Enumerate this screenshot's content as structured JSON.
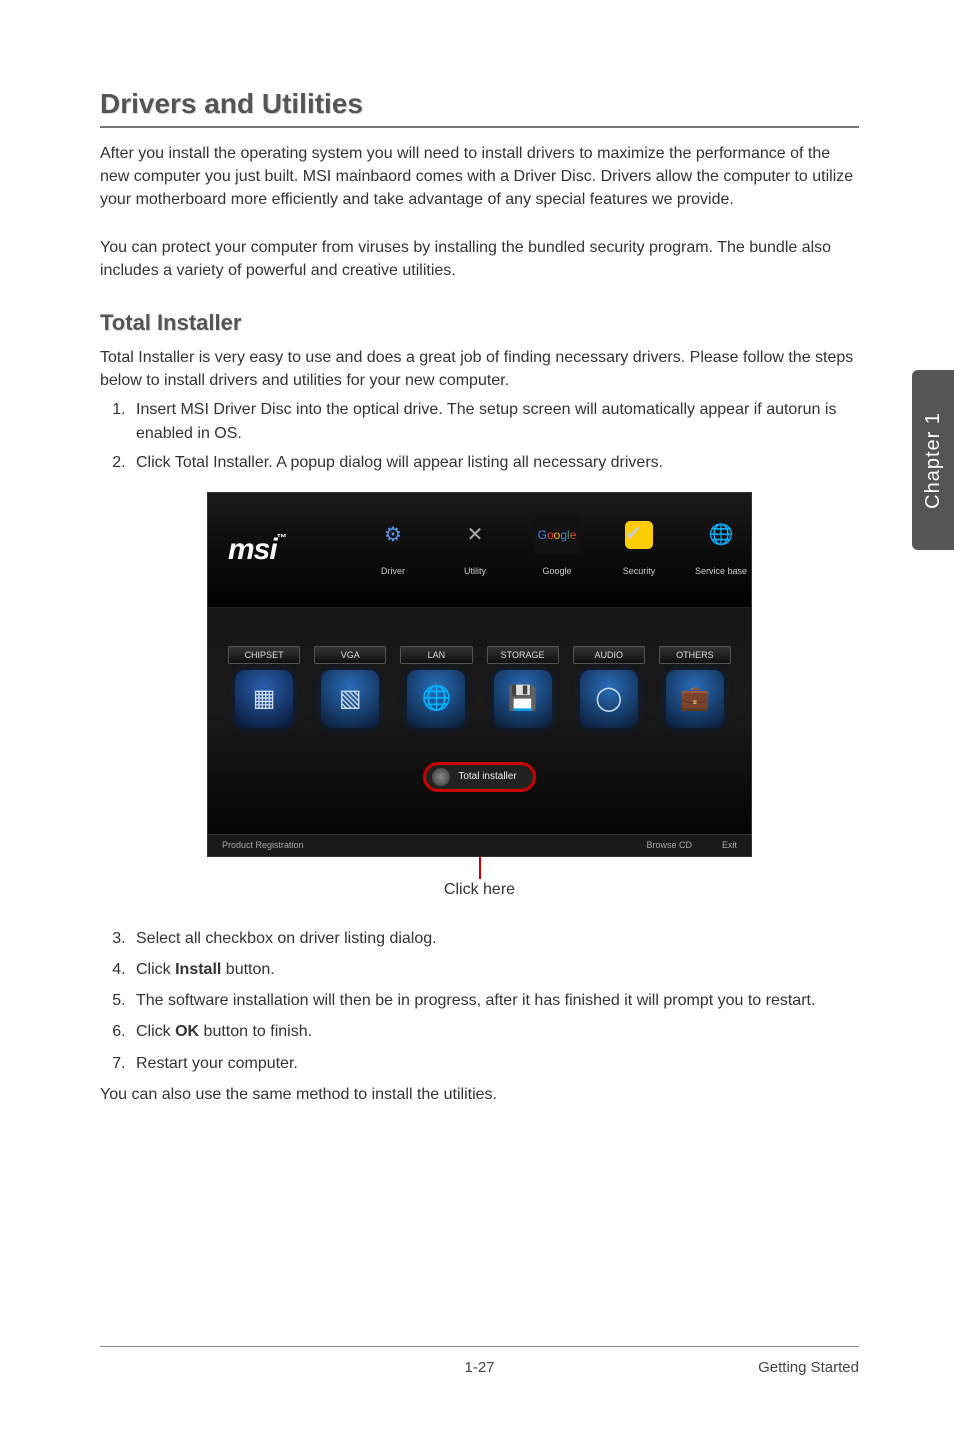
{
  "heading": "Drivers and Utilities",
  "intro1": "After you install the operating system you will need to install drivers to maximize the performance of the new computer you just built. MSI mainbaord comes with a Driver Disc. Drivers allow the computer to utilize your motherboard more efficiently and take advantage of any special features we provide.",
  "intro2": "You can protect your computer from viruses by installing the bundled security program. The bundle also includes a variety of powerful and creative utilities.",
  "sub_heading": "Total Installer",
  "sub_intro": "Total Installer is very easy to use and does a great job of finding necessary drivers. Please follow the steps below to install drivers and utilities for your new computer.",
  "steps_a": [
    "Insert MSI Driver Disc into the optical drive. The setup screen will automatically appear if autorun is enabled in OS.",
    "Click Total Installer. A popup dialog will appear listing all necessary drivers."
  ],
  "installer": {
    "logo": "msi",
    "top_tabs": [
      {
        "label": "Driver"
      },
      {
        "label": "Utility"
      },
      {
        "label": "Google"
      },
      {
        "label": "Security"
      },
      {
        "label": "Service base"
      }
    ],
    "categories": [
      "CHIPSET",
      "VGA",
      "LAN",
      "STORAGE",
      "AUDIO",
      "OTHERS"
    ],
    "total_btn": "Total installer",
    "bottom_left": "Product Registration",
    "bottom_mid": "Browse CD",
    "bottom_right": "Exit"
  },
  "callout": "Click here",
  "steps_b": [
    {
      "pre": "Select all checkbox on driver listing dialog."
    },
    {
      "pre": "Click ",
      "bold": "Install",
      "post": " button."
    },
    {
      "pre": "The software installation will then be in progress, after it has finished it will prompt you to restart."
    },
    {
      "pre": "Click ",
      "bold": "OK",
      "post": " button to finish."
    },
    {
      "pre": "Restart your computer."
    }
  ],
  "closing": "You can also use the same method to install the utilities.",
  "sidebar": "Chapter 1",
  "footer": {
    "page": "1-27",
    "section": "Getting Started"
  }
}
